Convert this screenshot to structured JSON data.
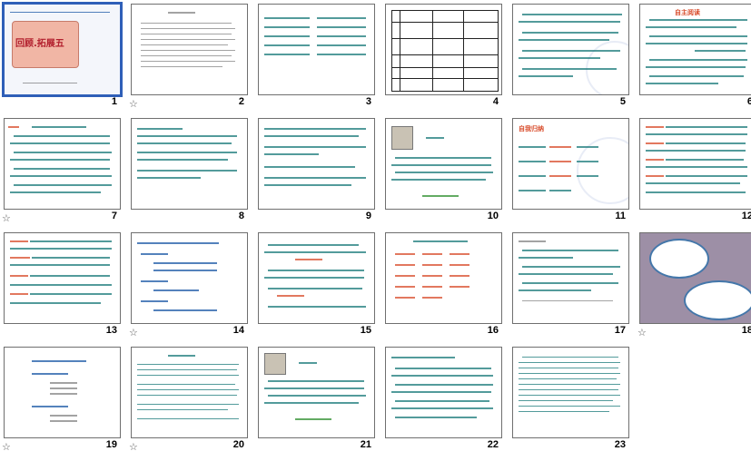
{
  "slides": [
    {
      "number": "1",
      "title": "回顾.拓展五",
      "star": false,
      "selected": true
    },
    {
      "number": "2",
      "star": true
    },
    {
      "number": "3",
      "star": false
    },
    {
      "number": "4",
      "star": false
    },
    {
      "number": "5",
      "star": false
    },
    {
      "number": "6",
      "title": "自主阅读",
      "star": false
    },
    {
      "number": "7",
      "star": true
    },
    {
      "number": "8",
      "star": false
    },
    {
      "number": "9",
      "star": false
    },
    {
      "number": "10",
      "star": false
    },
    {
      "number": "11",
      "title": "自我归纳",
      "star": false
    },
    {
      "number": "12",
      "star": false
    },
    {
      "number": "13",
      "star": false
    },
    {
      "number": "14",
      "star": true
    },
    {
      "number": "15",
      "star": false
    },
    {
      "number": "16",
      "star": false
    },
    {
      "number": "17",
      "star": false
    },
    {
      "number": "18",
      "star": true
    },
    {
      "number": "19",
      "star": false
    },
    {
      "number": "20",
      "star": true
    },
    {
      "number": "21",
      "star": false
    },
    {
      "number": "22",
      "star": false
    },
    {
      "number": "23",
      "star": false
    }
  ],
  "star_glyph": "☆",
  "colors": {
    "accent": "#2f5fb8",
    "teal": "#1a7a7a",
    "red": "#d84b2a"
  }
}
